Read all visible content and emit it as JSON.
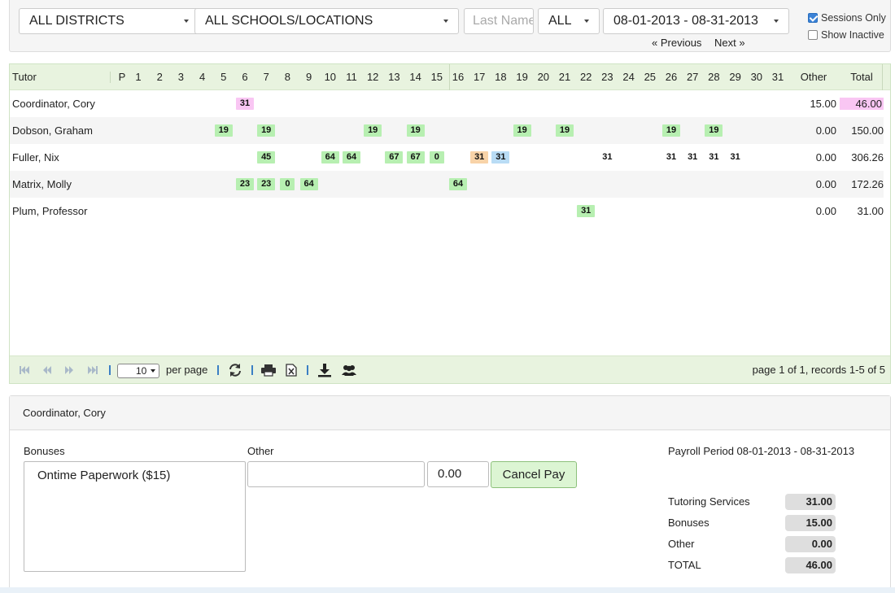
{
  "filters": {
    "district": "ALL DISTRICTS",
    "school": "ALL SCHOOLS/LOCATIONS",
    "last_name_placeholder": "Last Name",
    "type": "ALL",
    "date_range": "08-01-2013 - 08-31-2013",
    "previous": "« Previous",
    "next": "Next »",
    "sessions_only": "Sessions Only",
    "sessions_only_checked": true,
    "show_inactive": "Show Inactive",
    "show_inactive_checked": false
  },
  "grid": {
    "headers": {
      "tutor": "Tutor",
      "p": "P",
      "days": [
        "1",
        "2",
        "3",
        "4",
        "5",
        "6",
        "7",
        "8",
        "9",
        "10",
        "11",
        "12",
        "13",
        "14",
        "15",
        "16",
        "17",
        "18",
        "19",
        "20",
        "21",
        "22",
        "23",
        "24",
        "25",
        "26",
        "27",
        "28",
        "29",
        "30",
        "31"
      ],
      "other": "Other",
      "total": "Total"
    },
    "rows": [
      {
        "name": "Coordinator, Cory",
        "cells": [
          {
            "day": 6,
            "value": "31",
            "color": "pink"
          }
        ],
        "other": "15.00",
        "total": "46.00",
        "total_highlight": true
      },
      {
        "name": "Dobson, Graham",
        "cells": [
          {
            "day": 5,
            "value": "19",
            "color": "green"
          },
          {
            "day": 7,
            "value": "19",
            "color": "green"
          },
          {
            "day": 12,
            "value": "19",
            "color": "green"
          },
          {
            "day": 14,
            "value": "19",
            "color": "green"
          },
          {
            "day": 19,
            "value": "19",
            "color": "green"
          },
          {
            "day": 21,
            "value": "19",
            "color": "green"
          },
          {
            "day": 26,
            "value": "19",
            "color": "green"
          },
          {
            "day": 28,
            "value": "19",
            "color": "green"
          }
        ],
        "other": "0.00",
        "total": "150.00"
      },
      {
        "name": "Fuller, Nix",
        "cells": [
          {
            "day": 7,
            "value": "45",
            "color": "green"
          },
          {
            "day": 10,
            "value": "64",
            "color": "green"
          },
          {
            "day": 11,
            "value": "64",
            "color": "green"
          },
          {
            "day": 13,
            "value": "67",
            "color": "green"
          },
          {
            "day": 14,
            "value": "67",
            "color": "green"
          },
          {
            "day": 15,
            "value": "0",
            "color": "green"
          },
          {
            "day": 17,
            "value": "31",
            "color": "orange"
          },
          {
            "day": 18,
            "value": "31",
            "color": "blue"
          },
          {
            "day": 23,
            "value": "31",
            "color": "plain"
          },
          {
            "day": 26,
            "value": "31",
            "color": "plain"
          },
          {
            "day": 27,
            "value": "31",
            "color": "plain"
          },
          {
            "day": 28,
            "value": "31",
            "color": "plain"
          },
          {
            "day": 29,
            "value": "31",
            "color": "plain"
          }
        ],
        "other": "0.00",
        "total": "306.26"
      },
      {
        "name": "Matrix, Molly",
        "cells": [
          {
            "day": 6,
            "value": "23",
            "color": "green"
          },
          {
            "day": 7,
            "value": "23",
            "color": "green"
          },
          {
            "day": 8,
            "value": "0",
            "color": "green"
          },
          {
            "day": 9,
            "value": "64",
            "color": "green"
          },
          {
            "day": 16,
            "value": "64",
            "color": "green"
          }
        ],
        "other": "0.00",
        "total": "172.26"
      },
      {
        "name": "Plum, Professor",
        "cells": [
          {
            "day": 22,
            "value": "31",
            "color": "green"
          }
        ],
        "other": "0.00",
        "total": "31.00"
      }
    ]
  },
  "pager": {
    "page_size": "10",
    "per_page": "per page",
    "records": "page 1 of 1, records 1-5 of 5"
  },
  "detail": {
    "tutor": "Coordinator, Cory",
    "bonuses_label": "Bonuses",
    "bonus_option": "Ontime Paperwork ($15)",
    "other_label": "Other",
    "other_desc": "",
    "other_amount": "0.00",
    "cancel_pay": "Cancel Pay",
    "payroll_period": "Payroll Period 08-01-2013 - 08-31-2013",
    "summary": [
      {
        "label": "Tutoring Services",
        "value": "31.00"
      },
      {
        "label": "Bonuses",
        "value": "15.00"
      },
      {
        "label": "Other",
        "value": "0.00"
      },
      {
        "label": "TOTAL",
        "value": "46.00"
      }
    ]
  },
  "colors": {
    "green": "#b7efb1",
    "pink": "#f9c6f3",
    "orange": "#f8d3a8",
    "blue": "#b9dcf5",
    "grid_header": "#e8f3df"
  }
}
